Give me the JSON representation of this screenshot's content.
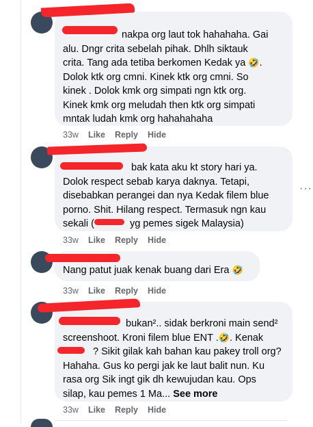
{
  "comments": [
    {
      "lines": [
        "nakpa org laut tok hahahaha. Gai",
        "alu. Dngr crita sebelah pihak. Dhlh siktauk",
        "crita. Tang ada tetiba berkomen Kedak ya",
        "Dolok ktk org cmni. Kinek ktk org cmni. So",
        "kinek . Dolok kmk org simpati ngn ktk org.",
        "Kinek kmk org meludah then ktk org simpati",
        "mntak ludah kmk org hahahahaha"
      ],
      "time": "33w",
      "like": "Like",
      "reply": "Reply",
      "hide": "Hide"
    },
    {
      "lines": [
        "bak kata aku kt story hari ya.",
        "Dolok respect sebab karya daknya. Tetapi,",
        "disebabkan perangei dan nya Kedak filem blue",
        "porno. Shit. Hilang respect. Termasuk ngn kau",
        "sekali (",
        "yg pemes sigek Malaysia)"
      ],
      "time": "33w",
      "like": "Like",
      "reply": "Reply",
      "hide": "Hide"
    },
    {
      "lines": [
        "Nang patut juak kenak buang dari Era"
      ],
      "time": "33w",
      "like": "Like",
      "reply": "Reply",
      "hide": "Hide"
    },
    {
      "lines": [
        "bukan².. sidak berkroni main send²",
        "screenshoot. Kroni filem blue ENT .",
        ". Kenak",
        "? Sikit gilak kah bahan kau pakey troll org?",
        "Hahaha. Gus ko pergi jak ke laut balit nun. Ku",
        "rasa org Sik ingt gik dh kewujudan kau. Ops",
        "silap, kau pemes 1 Ma..."
      ],
      "see_more": "See more",
      "time": "33w",
      "like": "Like",
      "reply": "Reply",
      "hide": "Hide"
    }
  ],
  "more_button": "···",
  "emoji": "🤣",
  "colors": {
    "bubble": "#f0f2f5",
    "redaction": "#f4262b",
    "meta": "#65676b"
  }
}
